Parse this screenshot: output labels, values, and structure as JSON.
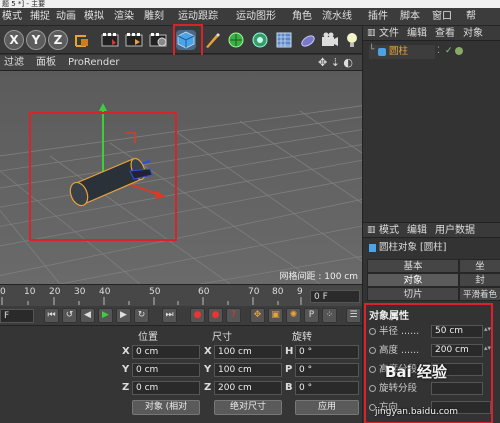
{
  "window": {
    "title": "题 5 *] - 主要"
  },
  "menu": [
    "文件",
    "编辑",
    "查看",
    "对象"
  ],
  "main_menu": [
    "模式",
    "捕捉",
    "动画",
    "模拟",
    "渲染",
    "雕刻",
    "运动跟踪",
    "运动图形",
    "角色",
    "流水线",
    "插件",
    "脚本",
    "窗口",
    "帮"
  ],
  "toolbar": {
    "axis_x": "X",
    "axis_y": "Y",
    "axis_z": "Z"
  },
  "viewport": {
    "menu": [
      "过滤",
      "面板",
      "ProRender"
    ],
    "grid_distance": "网格间距 : 100 cm"
  },
  "timeline": {
    "ticks": [
      "0",
      "10",
      "20",
      "30",
      "40",
      "50",
      "60",
      "70",
      "80",
      "9"
    ],
    "frame_value": "0 F",
    "start_frame": "F"
  },
  "coordinates": {
    "headers": [
      "位置",
      "尺寸",
      "旋转"
    ],
    "rows": [
      {
        "axis": "X",
        "pos": "0 cm",
        "size_axis": "X",
        "size": "100 cm",
        "rot_axis": "H",
        "rot": "0 °"
      },
      {
        "axis": "Y",
        "pos": "0 cm",
        "size_axis": "Y",
        "size": "100 cm",
        "rot_axis": "P",
        "rot": "0 °"
      },
      {
        "axis": "Z",
        "pos": "0 cm",
        "size_axis": "Z",
        "size": "200 cm",
        "rot_axis": "B",
        "rot": "0 °"
      }
    ],
    "mode_select": "对象 (相对",
    "size_select": "绝对尺寸",
    "apply": "应用"
  },
  "object_manager": {
    "menu": [
      "文件",
      "编辑",
      "查看",
      "对象"
    ],
    "object_name": "圆柱"
  },
  "attributes": {
    "menu": [
      "模式",
      "编辑",
      "用户数据"
    ],
    "title": "圆柱对象 [圆柱]",
    "tabs": [
      "基本",
      "坐",
      "对象",
      "封",
      "切片",
      "平滑着色"
    ],
    "section": "对象属性",
    "params": [
      {
        "label": "半径 ......",
        "value": "50 cm"
      },
      {
        "label": "高度 ......",
        "value": "200 cm"
      },
      {
        "label": "高度分段",
        "value": ""
      },
      {
        "label": "旋转分段",
        "value": ""
      },
      {
        "label": "方向",
        "value": ""
      }
    ]
  },
  "watermark": "jingyan.baidu.com",
  "watermark_brand": "Bai 经验"
}
